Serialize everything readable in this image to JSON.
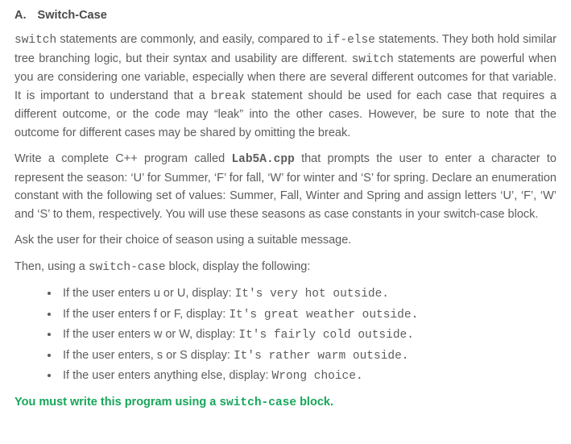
{
  "heading": {
    "label": "A.",
    "title": "Switch-Case"
  },
  "p1": {
    "t1": "switch",
    "t2": " statements are commonly, and easily, compared to ",
    "t3": "if-else",
    "t4": " statements. They both hold similar tree branching logic, but their syntax and usability are different. ",
    "t5": "switch",
    "t6": " statements are powerful when you are considering one variable, especially when there are several different outcomes for that variable. It is important to understand that a ",
    "t7": "break",
    "t8": " statement should be used for each case that requires a different outcome, or the code may “leak” into the other cases. However, be sure to note that the outcome for different cases may be shared by omitting the break."
  },
  "p2": {
    "t1": "Write a complete C++ program called ",
    "t2": "Lab5A.cpp",
    "t3": " that prompts the user to enter a character to represent the season: ‘U’ for Summer, ‘F’ for fall, ‘W’ for winter and ‘S’ for spring. Declare an enumeration constant with the following set of values: Summer, Fall, Winter and Spring and assign letters ‘U’, ‘F’, ‘W’ and ‘S’ to them, respectively. You will use these seasons as case constants in your switch-case block."
  },
  "p3": " Ask the user for their choice of season using a suitable message.",
  "p4": {
    "t1": "Then, using a ",
    "t2": "switch-case",
    "t3": " block, display the following:"
  },
  "list": [
    {
      "t1": "If the user enters u or U, display: ",
      "t2": "It's very hot outside."
    },
    {
      "t1": "If the user enters f or F, display: ",
      "t2": "It's great weather outside."
    },
    {
      "t1": "If the user enters w or W, display: ",
      "t2": "It's fairly cold outside."
    },
    {
      "t1": "If the user enters, s or S display: ",
      "t2": "It's rather warm outside."
    },
    {
      "t1": "If the user enters anything else, display: ",
      "t2": "Wrong choice."
    }
  ],
  "final": {
    "t1": "You must write this program using a ",
    "t2": "switch-case",
    "t3": " block."
  }
}
